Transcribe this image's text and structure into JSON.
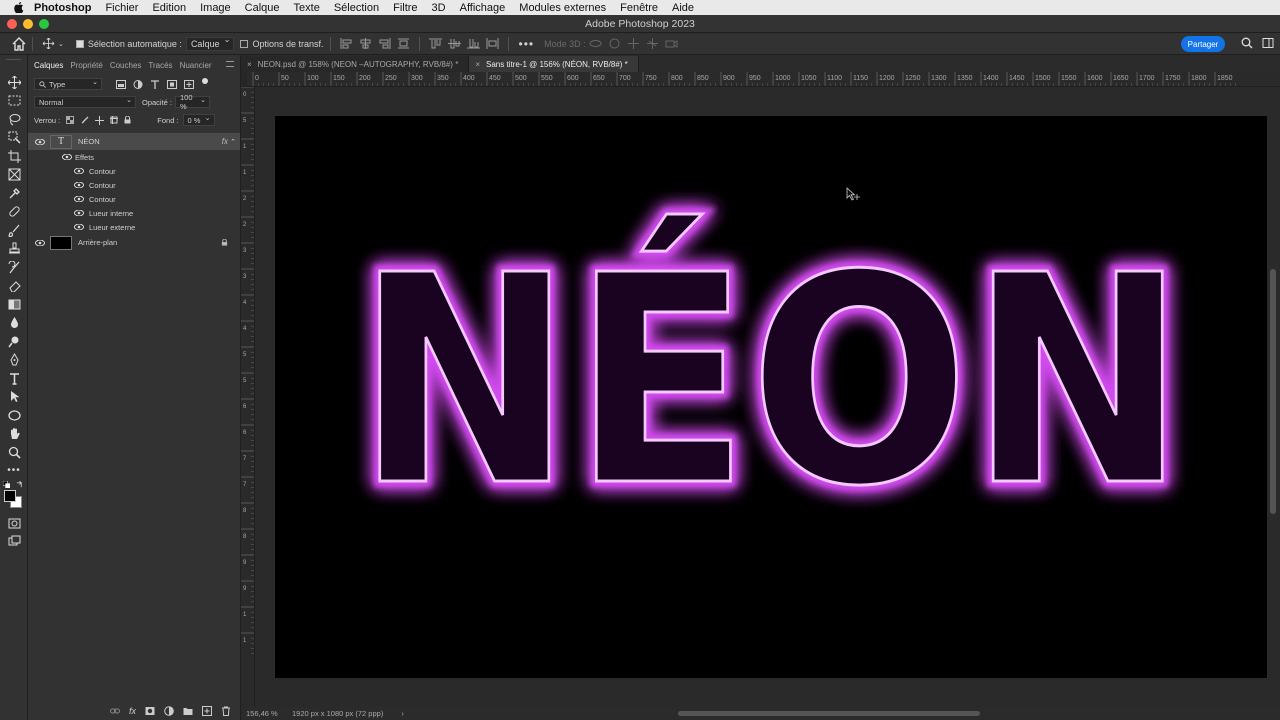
{
  "menubar": {
    "items": [
      {
        "label": "Photoshop",
        "bold": true
      },
      {
        "label": "Fichier"
      },
      {
        "label": "Edition"
      },
      {
        "label": "Image"
      },
      {
        "label": "Calque"
      },
      {
        "label": "Texte"
      },
      {
        "label": "Sélection"
      },
      {
        "label": "Filtre"
      },
      {
        "label": "3D"
      },
      {
        "label": "Affichage"
      },
      {
        "label": "Modules externes"
      },
      {
        "label": "Fenêtre"
      },
      {
        "label": "Aide"
      }
    ]
  },
  "window": {
    "title": "Adobe Photoshop 2023"
  },
  "options": {
    "auto_select_label": "Sélection automatique :",
    "auto_select_value": "Calque",
    "transform_label": "Options de transf.",
    "mode3d_label": "Mode 3D :",
    "share_label": "Partager"
  },
  "panel": {
    "tabs": [
      {
        "label": "Calques",
        "active": true
      },
      {
        "label": "Propriété",
        "active": false
      },
      {
        "label": "Couches",
        "active": false
      },
      {
        "label": "Tracés",
        "active": false
      },
      {
        "label": "Nuancier",
        "active": false
      }
    ],
    "filter_label": "Type",
    "blend_mode": "Normal",
    "opacity_label": "Opacité :",
    "opacity_value": "100 %",
    "lock_label": "Verrou :",
    "fill_label": "Fond :",
    "fill_value": "0 %",
    "text_layer": {
      "name": "NÉON",
      "thumb_glyph": "T",
      "fx_label": "fx"
    },
    "effects_label": "Effets",
    "effects": [
      "Contour",
      "Contour",
      "Contour",
      "Lueur interne",
      "Lueur externe"
    ],
    "background_layer": {
      "name": "Arrière-plan"
    }
  },
  "tabs": [
    {
      "label": "NEON.psd @ 158% (NEON –AUTOGRAPHY, RVB/8#) *",
      "active": false
    },
    {
      "label": "Sans titre-1 @ 156% (NÉON, RVB/8#) *",
      "active": true
    }
  ],
  "ruler": {
    "labels": [
      "0",
      "50",
      "100",
      "150",
      "200",
      "250",
      "300",
      "350",
      "400",
      "450",
      "500",
      "550",
      "600",
      "650",
      "700",
      "750",
      "800",
      "850",
      "900",
      "950",
      "1000",
      "1050",
      "1100",
      "1150",
      "1200",
      "1250",
      "1300",
      "1350",
      "1400",
      "1450",
      "1500",
      "1550",
      "1600",
      "1650",
      "1700",
      "1750",
      "1800",
      "1850"
    ],
    "left_labels": [
      "0",
      "5",
      "1",
      "1",
      "2",
      "2",
      "3",
      "3",
      "4",
      "4",
      "5",
      "5",
      "6",
      "6",
      "7",
      "7",
      "8",
      "8",
      "9",
      "9",
      "1",
      "1"
    ]
  },
  "canvas": {
    "text": "NÉON",
    "stroke_color": "#f4c9ff",
    "glow_color": "#d24bef",
    "fill_color": "#1a0320"
  },
  "status": {
    "zoom": "156,46 %",
    "dims": "1920 px x 1080 px (72 ppp)",
    "arrow": "›"
  },
  "colors": {
    "accent": "#1473e6",
    "light_red": "#fe5f57",
    "light_yellow": "#febc2e",
    "light_green": "#28c840"
  }
}
